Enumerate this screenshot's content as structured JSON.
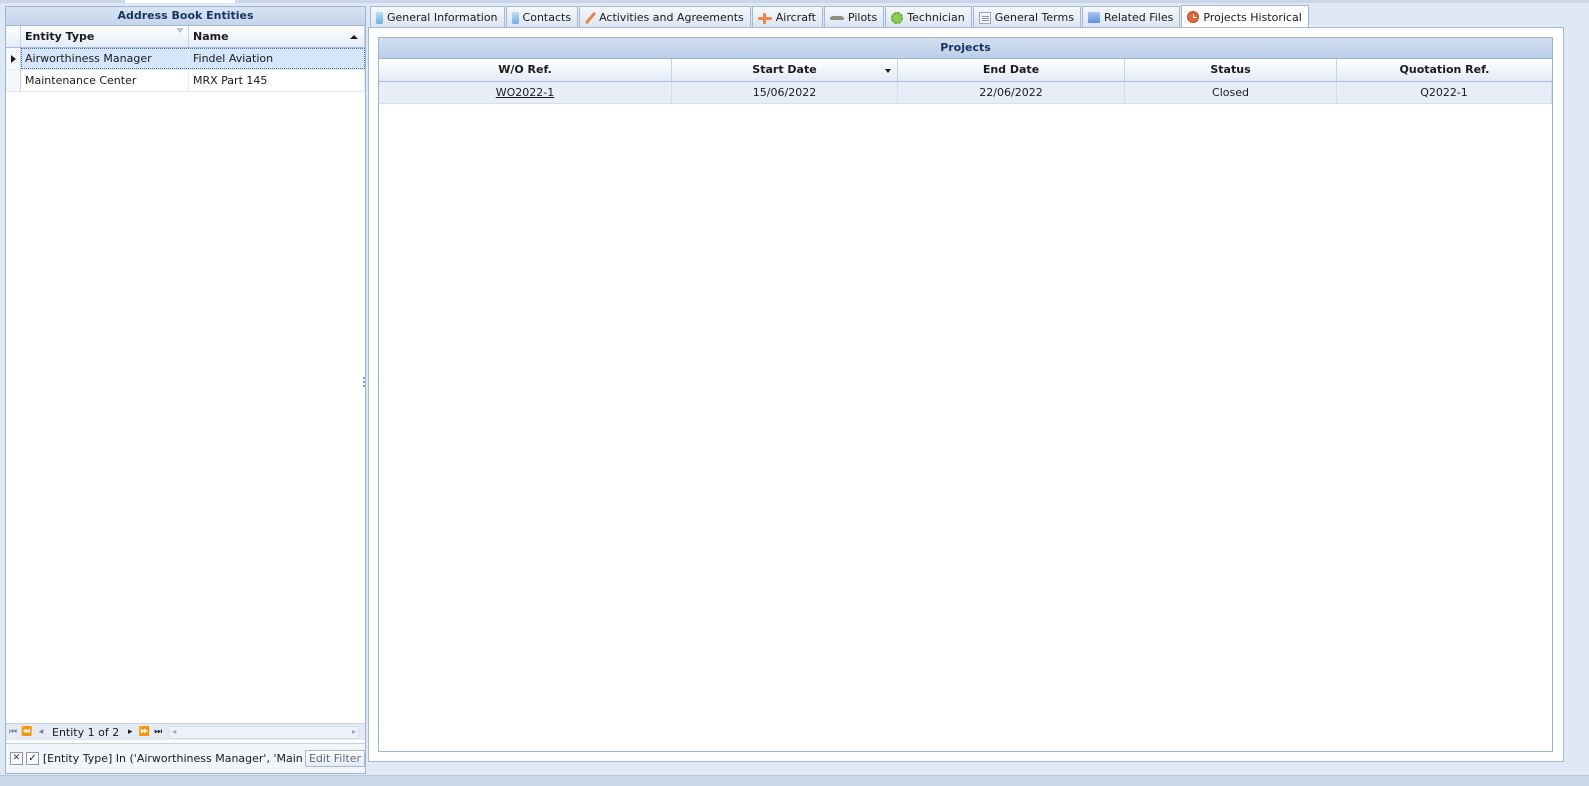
{
  "left_panel": {
    "title": "Address Book Entities",
    "columns": {
      "entity_type": "Entity Type",
      "name": "Name"
    },
    "rows": [
      {
        "entity_type": "Airworthiness Manager",
        "name": "Findel Aviation",
        "selected": true
      },
      {
        "entity_type": "Maintenance Center",
        "name": "MRX Part 145",
        "selected": false
      }
    ],
    "navigator": {
      "text": "Entity 1 of 2"
    },
    "filter": {
      "text": "[Entity Type] In ('Airworthiness Manager', 'Maintenanc...",
      "edit_label": "Edit Filter"
    }
  },
  "tabs": [
    {
      "label": "General Information",
      "icon": "book-icon"
    },
    {
      "label": "Contacts",
      "icon": "book-icon"
    },
    {
      "label": "Activities and Agreements",
      "icon": "wrench-icon"
    },
    {
      "label": "Aircraft",
      "icon": "airplane-icon"
    },
    {
      "label": "Pilots",
      "icon": "pilot-wings-icon"
    },
    {
      "label": "Technician",
      "icon": "gear-icon"
    },
    {
      "label": "General Terms",
      "icon": "document-icon"
    },
    {
      "label": "Related Files",
      "icon": "folder-icon"
    },
    {
      "label": "Projects Historical",
      "icon": "clock-icon",
      "active": true
    }
  ],
  "projects": {
    "title": "Projects",
    "columns": {
      "wo_ref": "W/O Ref.",
      "start_date": "Start Date",
      "end_date": "End Date",
      "status": "Status",
      "quotation_ref": "Quotation Ref."
    },
    "rows": [
      {
        "wo_ref": "WO2022-1",
        "start_date": "15/06/2022",
        "end_date": "22/06/2022",
        "status": "Closed",
        "quotation_ref": "Q2022-1"
      }
    ]
  },
  "colors": {
    "header_bg": "#c5d5ec",
    "selected_row": "#d5e5fa",
    "active_icon": "#e0693a"
  }
}
